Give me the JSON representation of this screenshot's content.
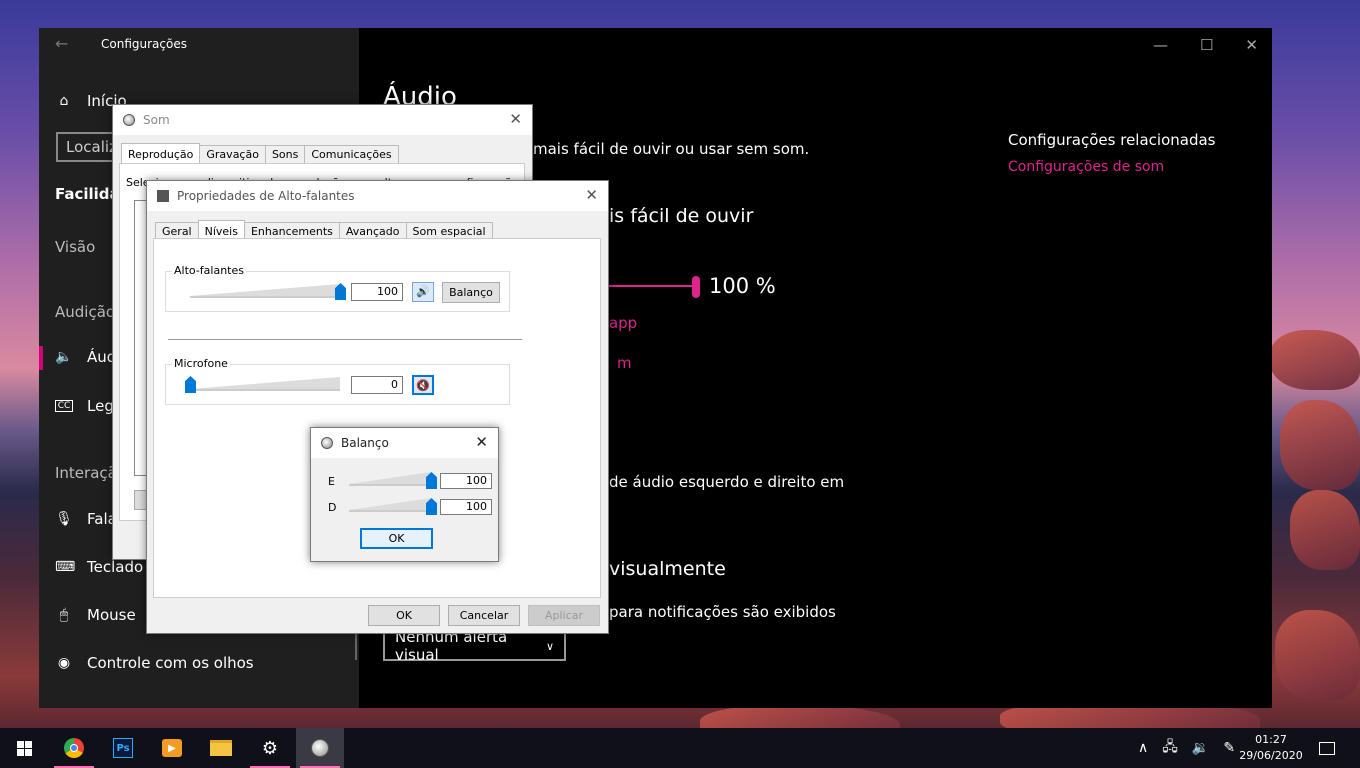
{
  "settings": {
    "app_title": "Configurações",
    "nav": {
      "home": "Início",
      "search_placeholder": "Localiz",
      "section_ease": "Facilidad",
      "header_vision": "Visão",
      "header_audio": "Audição",
      "item_audio": "Áud",
      "item_captions": "Lege",
      "header_interaction": "Interaçã",
      "item_speech": "Fala",
      "item_keyboard": "Teclado",
      "item_mouse": "Mouse",
      "item_eye_control": "Controle com os olhos"
    },
    "main": {
      "page_title": "Áudio",
      "subtitle_fragment": "mais fácil de ouvir ou usar sem som.",
      "heading_fragment": "is fácil de ouvir",
      "volume_value": "100 %",
      "link_fragment_1": "o app",
      "link_fragment_2": "m",
      "mono_fragment": "de áudio esquerdo e direito em",
      "heading_visual_fragment": "visualmente",
      "notif_fragment": "para notificações são exibidos",
      "visual_alert_select": "Nenhum alerta visual",
      "related_title": "Configurações relacionadas",
      "related_link": "Configurações de som"
    }
  },
  "som_dialog": {
    "title": "Som",
    "tabs": [
      "Reprodução",
      "Gravação",
      "Sons",
      "Comunicações"
    ],
    "instruction": "Selecione um dispositivo de reprodução para alterar suas configurações:"
  },
  "props_dialog": {
    "title": "Propriedades de Alto-falantes",
    "tabs": [
      "Geral",
      "Níveis",
      "Enhancements",
      "Avançado",
      "Som espacial"
    ],
    "speakers_label": "Alto-falantes",
    "speakers_value": "100",
    "speakers_level": 1.0,
    "balance_button": "Balanço",
    "mic_label": "Microfone",
    "mic_value": "0",
    "mic_level": 0.0,
    "ok": "OK",
    "cancel": "Cancelar",
    "apply": "Aplicar"
  },
  "balance_dialog": {
    "title": "Balanço",
    "left_label": "E",
    "left_value": "100",
    "left_level": 1.0,
    "right_label": "D",
    "right_value": "100",
    "right_level": 1.0,
    "ok": "OK"
  },
  "taskbar": {
    "time": "01:27",
    "date": "29/06/2020"
  }
}
